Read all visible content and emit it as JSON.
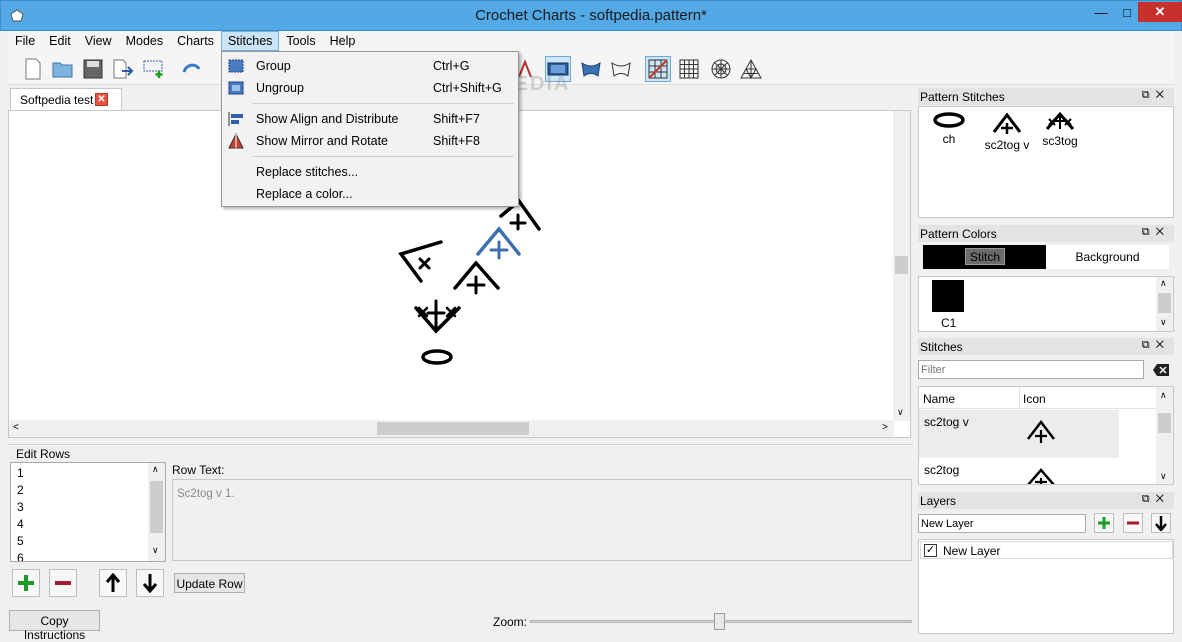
{
  "window": {
    "title": "Crochet Charts - softpedia.pattern*"
  },
  "menubar": [
    "File",
    "Edit",
    "View",
    "Modes",
    "Charts",
    "Stitches",
    "Tools",
    "Help"
  ],
  "open_menu": "Stitches",
  "stitches_menu": [
    {
      "label": "Group",
      "shortcut": "Ctrl+G",
      "icon": "group-icon"
    },
    {
      "label": "Ungroup",
      "shortcut": "Ctrl+Shift+G",
      "icon": "ungroup-icon"
    },
    {
      "label": "Show Align and Distribute",
      "shortcut": "Shift+F7",
      "icon": "align-icon"
    },
    {
      "label": "Show Mirror and Rotate",
      "shortcut": "Shift+F8",
      "icon": "mirror-icon"
    },
    {
      "label": "Replace stitches...",
      "shortcut": ""
    },
    {
      "label": "Replace a color...",
      "shortcut": ""
    }
  ],
  "watermark": "SOFTPEDIA",
  "tab": {
    "label": "Softpedia test"
  },
  "edit_rows": {
    "title": "Edit Rows",
    "rows": [
      "1",
      "2",
      "3",
      "4",
      "5",
      "6"
    ],
    "row_text_label": "Row Text:",
    "row_text": "Sc2tog v 1.",
    "update_label": "Update Row",
    "copy_label": "Copy Instructions",
    "zoom_label": "Zoom:",
    "zoom_value": 0.5
  },
  "pattern_stitches": {
    "title": "Pattern Stitches",
    "items": [
      {
        "label": "ch",
        "icon": "chain-oval-icon"
      },
      {
        "label": "sc2tog v",
        "icon": "sc2tog-v-icon"
      },
      {
        "label": "sc3tog",
        "icon": "sc3tog-icon"
      }
    ]
  },
  "pattern_colors": {
    "title": "Pattern Colors",
    "stitch_label": "Stitch",
    "background_label": "Background",
    "swatch_label": "C1",
    "stitch_color": "#000000",
    "background_color": "#ffffff"
  },
  "stitches": {
    "title": "Stitches",
    "filter_placeholder": "Filter",
    "col_name": "Name",
    "col_icon": "Icon",
    "rows": [
      "sc2tog v",
      "sc2tog"
    ]
  },
  "layers": {
    "title": "Layers",
    "input_value": "New Layer",
    "items": [
      {
        "label": "New Layer",
        "checked": true
      }
    ]
  },
  "colors": {
    "selected_stitch": "#3e6fad",
    "accent": "#53a8e6"
  }
}
